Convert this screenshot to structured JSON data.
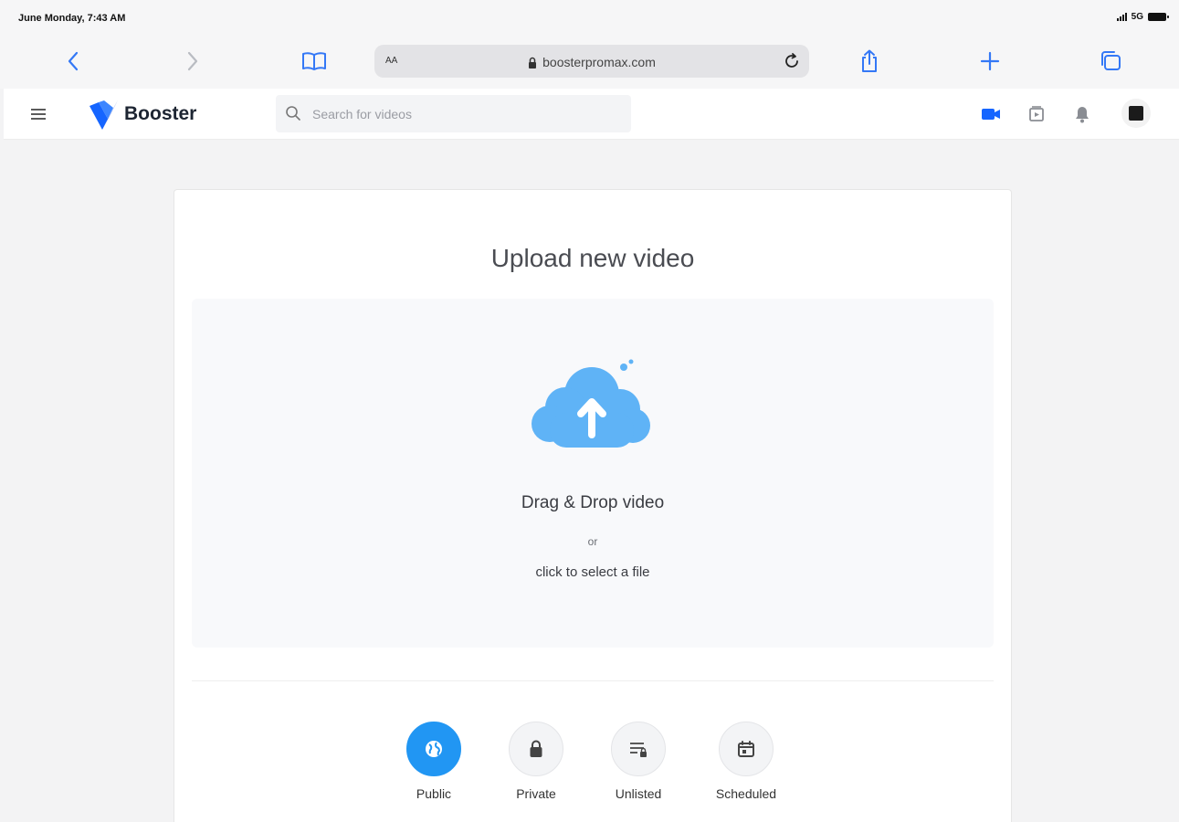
{
  "status_bar": {
    "time": "June Monday, 7:43 AM",
    "network": "5G"
  },
  "browser": {
    "text_size_label": "AA",
    "url": "boosterpromax.com",
    "icons": {
      "back": "chevron-left-icon",
      "forward": "chevron-right-icon",
      "bookmarks": "book-icon",
      "share": "share-icon",
      "new_tab": "plus-icon",
      "tabs": "tabs-icon",
      "reload": "reload-icon",
      "lock": "lock-icon"
    },
    "accent_color": "#3478f6"
  },
  "header": {
    "app_name": "Booster",
    "search_placeholder": "Search for videos",
    "icons": [
      "menu-icon",
      "video-camera-icon",
      "playlist-icon",
      "bell-icon",
      "avatar"
    ],
    "brand_color": "#1565ff"
  },
  "upload": {
    "title": "Upload new video",
    "drop_text": "Drag & Drop video",
    "or_text": "or",
    "click_text": "click to select a file",
    "cloud_color": "#5fb3f6"
  },
  "visibility": {
    "selected": "Public",
    "options": [
      {
        "label": "Public",
        "icon": "globe-icon",
        "active": true
      },
      {
        "label": "Private",
        "icon": "lock-icon",
        "active": false
      },
      {
        "label": "Unlisted",
        "icon": "unlisted-icon",
        "active": false
      },
      {
        "label": "Scheduled",
        "icon": "calendar-icon",
        "active": false
      }
    ],
    "active_color": "#2196f3"
  }
}
